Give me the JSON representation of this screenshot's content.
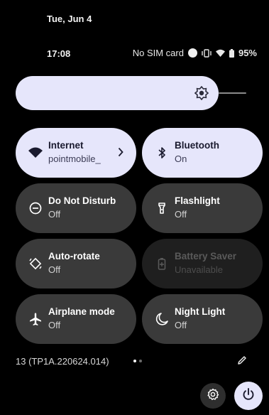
{
  "status_bar": {
    "date": "Tue, Jun 4",
    "time": "17:08",
    "carrier": "No SIM card",
    "battery_percent": "95%",
    "icons": [
      "sim-dot-icon",
      "vibrate-icon",
      "wifi-icon",
      "battery-icon"
    ]
  },
  "brightness": {
    "icon": "brightness-icon",
    "level": 0.83
  },
  "tiles": [
    {
      "label": "Internet",
      "sub": "pointmobile_",
      "state": "on",
      "icon": "wifi-icon",
      "chevron": true
    },
    {
      "label": "Bluetooth",
      "sub": "On",
      "state": "on",
      "icon": "bluetooth-icon"
    },
    {
      "label": "Do Not Disturb",
      "sub": "Off",
      "state": "off",
      "icon": "do-not-disturb-icon"
    },
    {
      "label": "Flashlight",
      "sub": "Off",
      "state": "off",
      "icon": "flashlight-icon"
    },
    {
      "label": "Auto-rotate",
      "sub": "Off",
      "state": "off",
      "icon": "auto-rotate-icon"
    },
    {
      "label": "Battery Saver",
      "sub": "Unavailable",
      "state": "disabled",
      "icon": "battery-saver-icon"
    },
    {
      "label": "Airplane mode",
      "sub": "Off",
      "state": "off",
      "icon": "airplane-icon"
    },
    {
      "label": "Night Light",
      "sub": "Off",
      "state": "off",
      "icon": "night-light-icon"
    }
  ],
  "footer": {
    "build": "13 (TP1A.220624.014)",
    "page_count": 2,
    "current_page": 1,
    "edit_icon": "edit-icon",
    "settings_icon": "settings-icon",
    "power_icon": "power-icon"
  },
  "colors": {
    "background": "#000000",
    "tile_on": "#e6e6fb",
    "tile_off": "#3a3a3a",
    "tile_disabled": "#1f1f1f"
  }
}
